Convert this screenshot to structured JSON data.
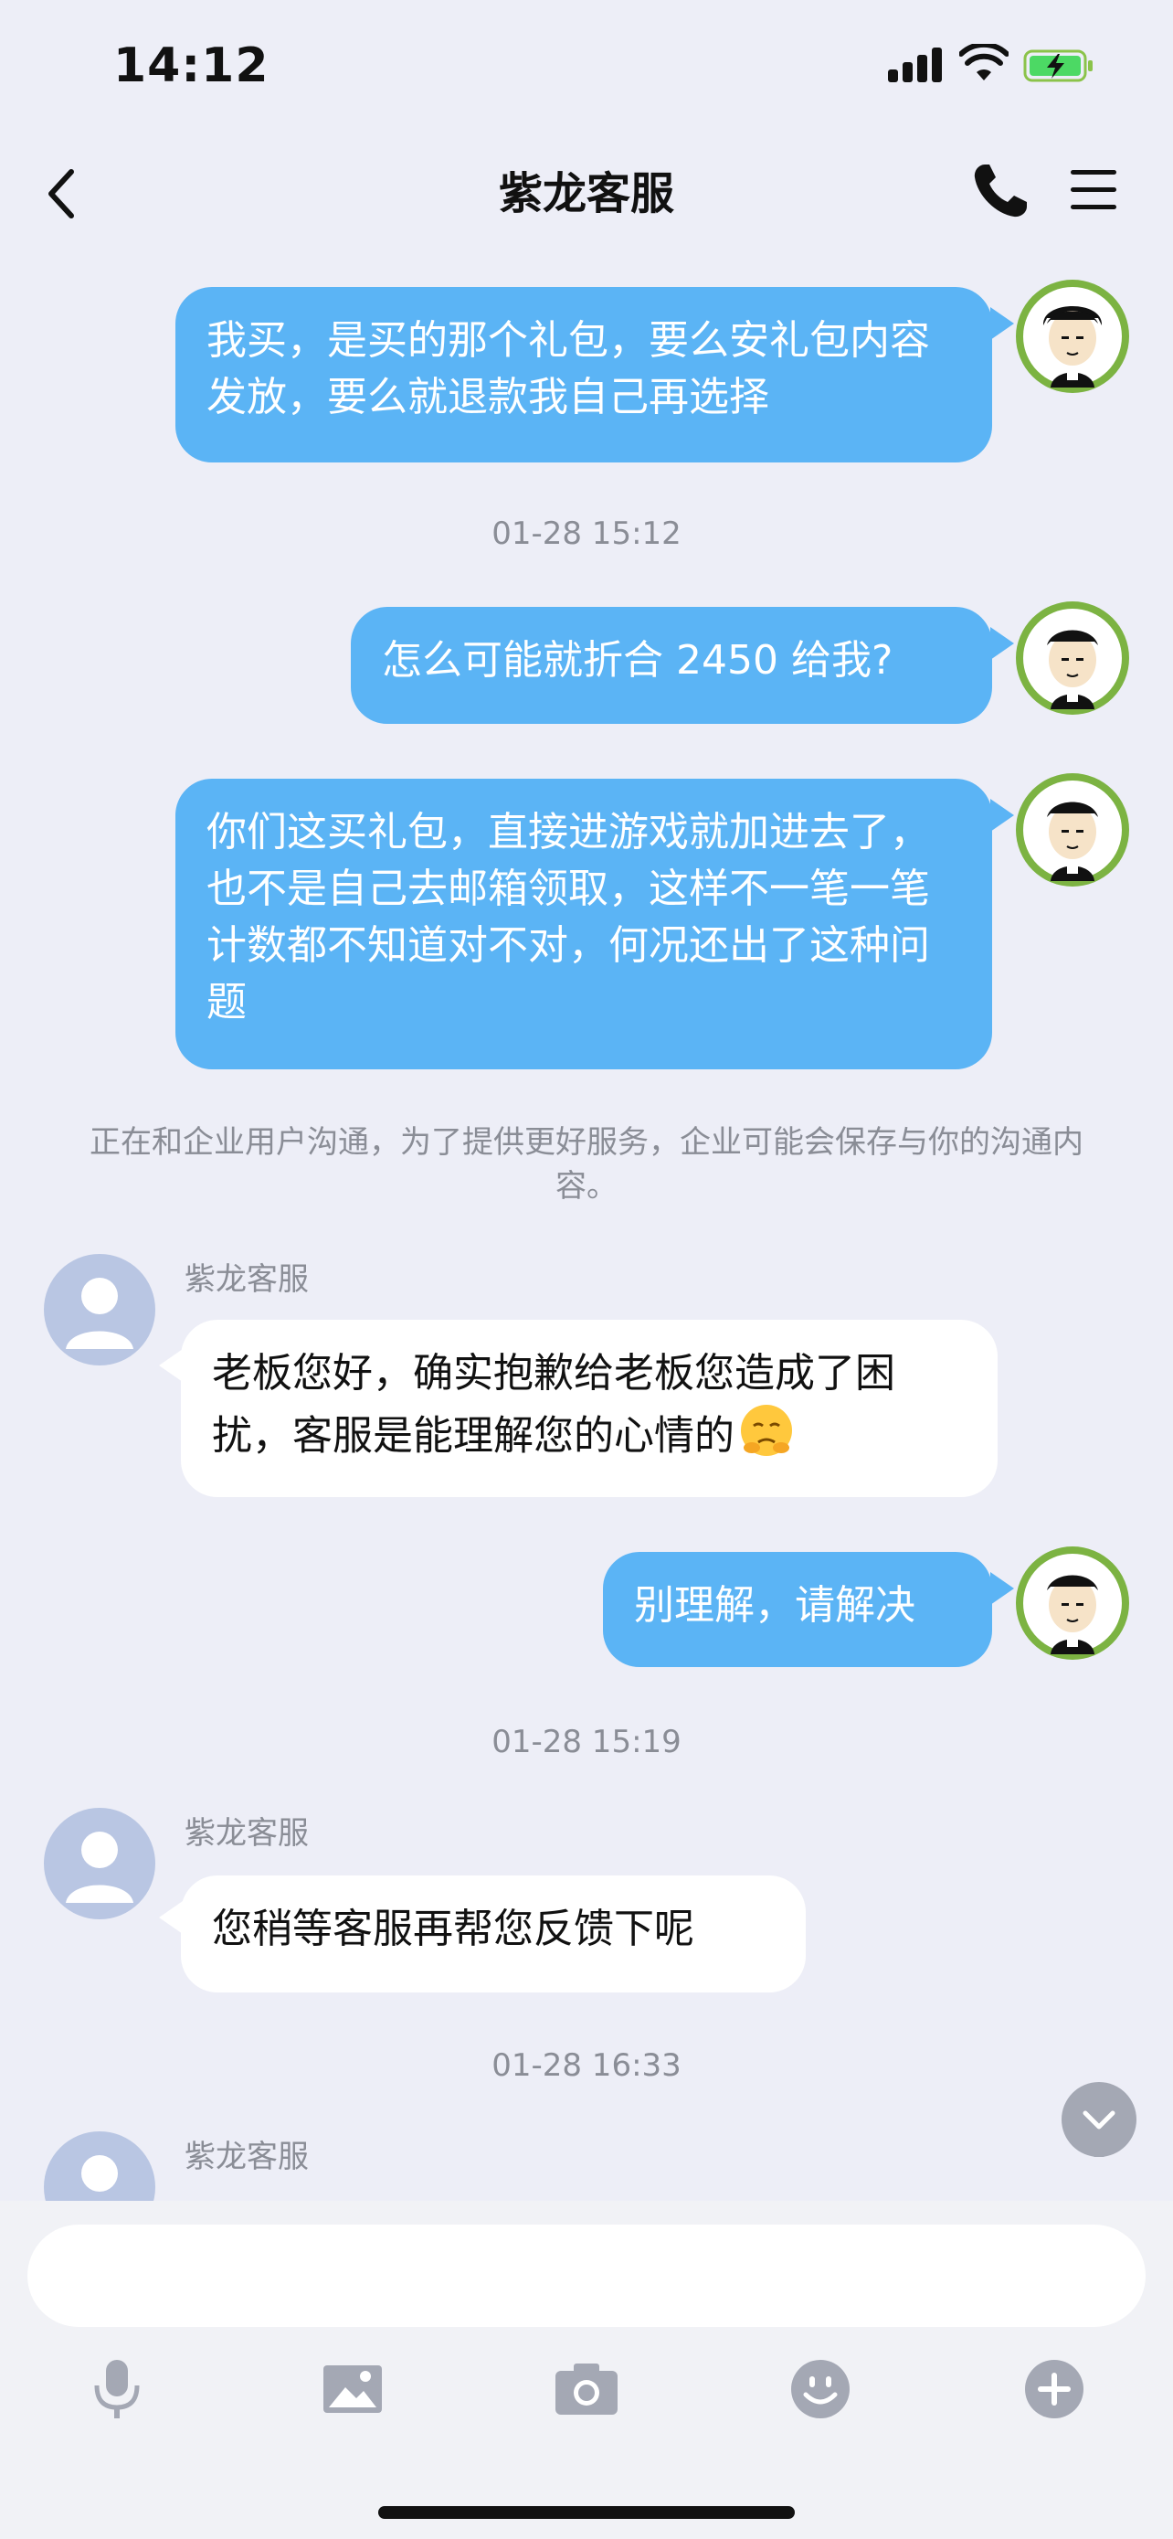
{
  "status_bar": {
    "time": "14:12"
  },
  "header": {
    "title": "紫龙客服"
  },
  "messages": {
    "m1": {
      "text": "我买，是买的那个礼包，要么安礼包内容发放，要么就退款我自己再选择"
    },
    "ts1": "01-28 15:12",
    "m2": {
      "text": "怎么可能就折合 2450 给我?"
    },
    "m3": {
      "text": "你们这买礼包，直接进游戏就加进去了，也不是自己去邮箱领取，这样不一笔一笔计数都不知道对不对，何况还出了这种问题"
    },
    "notice": "正在和企业用户沟通，为了提供更好服务，企业可能会保存与你的沟通内容。",
    "m4": {
      "sender": "紫龙客服",
      "text": "老板您好，确实抱歉给老板您造成了困扰，客服是能理解您的心情的"
    },
    "m5": {
      "text": "别理解，请解决"
    },
    "ts2": "01-28 15:19",
    "m6": {
      "sender": "紫龙客服",
      "text": "您稍等客服再帮您反馈下呢"
    },
    "ts3": "01-28 16:33",
    "m7": {
      "sender": "紫龙客服"
    }
  },
  "input": {
    "placeholder": ""
  },
  "toolbar": {
    "icons": [
      "microphone-icon",
      "image-icon",
      "camera-icon",
      "emoji-icon",
      "plus-icon"
    ]
  },
  "colors": {
    "background": "#EDEEF7",
    "outgoing_bubble": "#5BB4F5",
    "incoming_bubble": "#FFFFFF",
    "meta_text": "#8A8D96"
  }
}
